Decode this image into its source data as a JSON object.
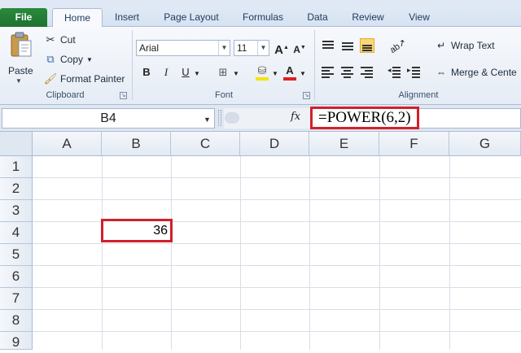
{
  "tabs": [
    {
      "label": "File"
    },
    {
      "label": "Home"
    },
    {
      "label": "Insert"
    },
    {
      "label": "Page Layout"
    },
    {
      "label": "Formulas"
    },
    {
      "label": "Data"
    },
    {
      "label": "Review"
    },
    {
      "label": "View"
    }
  ],
  "active_tab": "Home",
  "ribbon": {
    "clipboard": {
      "label": "Clipboard",
      "paste": "Paste",
      "cut": "Cut",
      "copy": "Copy",
      "format_painter": "Format Painter"
    },
    "font": {
      "label": "Font",
      "font_name": "Arial",
      "font_size": "11",
      "grow": "A",
      "shrink": "A",
      "bold": "B",
      "italic": "I",
      "underline": "U",
      "font_color_glyph": "A"
    },
    "alignment": {
      "label": "Alignment",
      "wrap_text": "Wrap Text",
      "merge_center": "Merge & Cente"
    }
  },
  "formula_bar": {
    "name_box": "B4",
    "fx": "fx",
    "formula": "=POWER(6,2)"
  },
  "grid": {
    "columns": [
      "A",
      "B",
      "C",
      "D",
      "E",
      "F",
      "G"
    ],
    "rows": [
      "1",
      "2",
      "3",
      "4",
      "5",
      "6",
      "7",
      "8",
      "9"
    ],
    "cells": {
      "B4": "36"
    }
  },
  "colors": {
    "highlight_border": "#d1202a",
    "file_tab": "#1d7330",
    "ribbon_bg": "#e5ecf5"
  }
}
